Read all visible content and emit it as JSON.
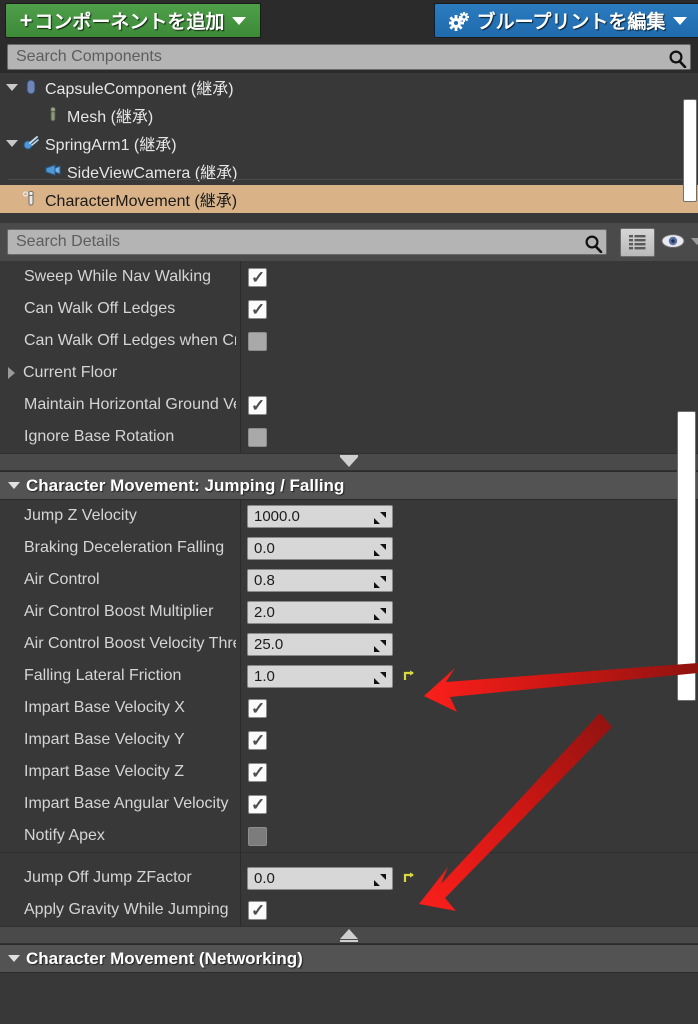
{
  "toolbar": {
    "add_component_label": "コンポーネントを追加",
    "edit_blueprint_label": "ブループリントを編集",
    "plus_glyph": "+",
    "gear_icon": "gears-icon"
  },
  "component_search": {
    "placeholder": "Search Components",
    "value": ""
  },
  "component_tree": {
    "items": [
      {
        "label": "CapsuleComponent (継承)",
        "indent": 0,
        "expandable": true,
        "selected": false,
        "icon": "capsule-icon"
      },
      {
        "label": "Mesh (継承)",
        "indent": 1,
        "expandable": false,
        "selected": false,
        "icon": "mesh-icon"
      },
      {
        "label": "SpringArm1 (継承)",
        "indent": 0,
        "expandable": true,
        "selected": false,
        "icon": "springarm-icon"
      },
      {
        "label": "SideViewCamera (継承)",
        "indent": 1,
        "expandable": false,
        "selected": false,
        "icon": "camera-icon"
      },
      {
        "label": "CharacterMovement (継承)",
        "indent": 0,
        "expandable": false,
        "selected": true,
        "icon": "charactermovement-icon"
      }
    ],
    "selected_bg": "#d9b387"
  },
  "details_toolbar": {
    "search_placeholder": "Search Details",
    "search_value": "",
    "grid_button": "grid-view-button",
    "eye_button": "visibility-eye-button"
  },
  "details": {
    "rows": [
      {
        "kind": "prop-checkbox",
        "label": "Sweep While Nav Walking",
        "checked": true,
        "dark": false,
        "reset": false
      },
      {
        "kind": "prop-checkbox",
        "label": "Can Walk Off Ledges",
        "checked": true,
        "dark": false,
        "reset": false
      },
      {
        "kind": "prop-checkbox",
        "label": "Can Walk Off Ledges when Cro",
        "checked": false,
        "dark": false,
        "reset": false
      },
      {
        "kind": "prop-expand",
        "label": "Current Floor"
      },
      {
        "kind": "prop-checkbox",
        "label": "Maintain Horizontal Ground Ve",
        "checked": true,
        "dark": false,
        "reset": false
      },
      {
        "kind": "prop-checkbox",
        "label": "Ignore Base Rotation",
        "checked": false,
        "dark": false,
        "reset": false
      },
      {
        "kind": "band-down"
      },
      {
        "kind": "category",
        "label": "Character Movement: Jumping / Falling"
      },
      {
        "kind": "prop-number",
        "label": "Jump Z Velocity",
        "value": "1000.0",
        "reset": false
      },
      {
        "kind": "prop-number",
        "label": "Braking Deceleration Falling",
        "value": "0.0",
        "reset": false
      },
      {
        "kind": "prop-number",
        "label": "Air Control",
        "value": "0.8",
        "reset": false
      },
      {
        "kind": "prop-number",
        "label": "Air Control Boost Multiplier",
        "value": "2.0",
        "reset": false
      },
      {
        "kind": "prop-number",
        "label": "Air Control Boost Velocity Thre",
        "value": "25.0",
        "reset": false
      },
      {
        "kind": "prop-number",
        "label": "Falling Lateral Friction",
        "value": "1.0",
        "reset": true
      },
      {
        "kind": "prop-checkbox",
        "label": "Impart Base Velocity X",
        "checked": true,
        "dark": false,
        "reset": false
      },
      {
        "kind": "prop-checkbox",
        "label": "Impart Base Velocity Y",
        "checked": true,
        "dark": false,
        "reset": false
      },
      {
        "kind": "prop-checkbox",
        "label": "Impart Base Velocity Z",
        "checked": true,
        "dark": false,
        "reset": false
      },
      {
        "kind": "prop-checkbox",
        "label": "Impart Base Angular Velocity",
        "checked": true,
        "dark": false,
        "reset": false
      },
      {
        "kind": "prop-checkbox",
        "label": "Notify Apex",
        "checked": false,
        "dark": true,
        "reset": false
      },
      {
        "kind": "separator"
      },
      {
        "kind": "prop-number",
        "label": "Jump Off Jump ZFactor",
        "value": "0.0",
        "reset": true
      },
      {
        "kind": "prop-checkbox",
        "label": "Apply Gravity While Jumping",
        "checked": true,
        "dark": false,
        "reset": false
      },
      {
        "kind": "band-up"
      },
      {
        "kind": "category",
        "label": "Character Movement (Networking)"
      }
    ]
  },
  "annotations": {
    "arrow_color": "#e01b18",
    "arrows": [
      {
        "name": "arrow-falling-lateral-friction",
        "points_to": "Falling Lateral Friction reset"
      },
      {
        "name": "arrow-jump-off-jump-zfactor",
        "points_to": "Jump Off Jump ZFactor reset"
      }
    ]
  }
}
